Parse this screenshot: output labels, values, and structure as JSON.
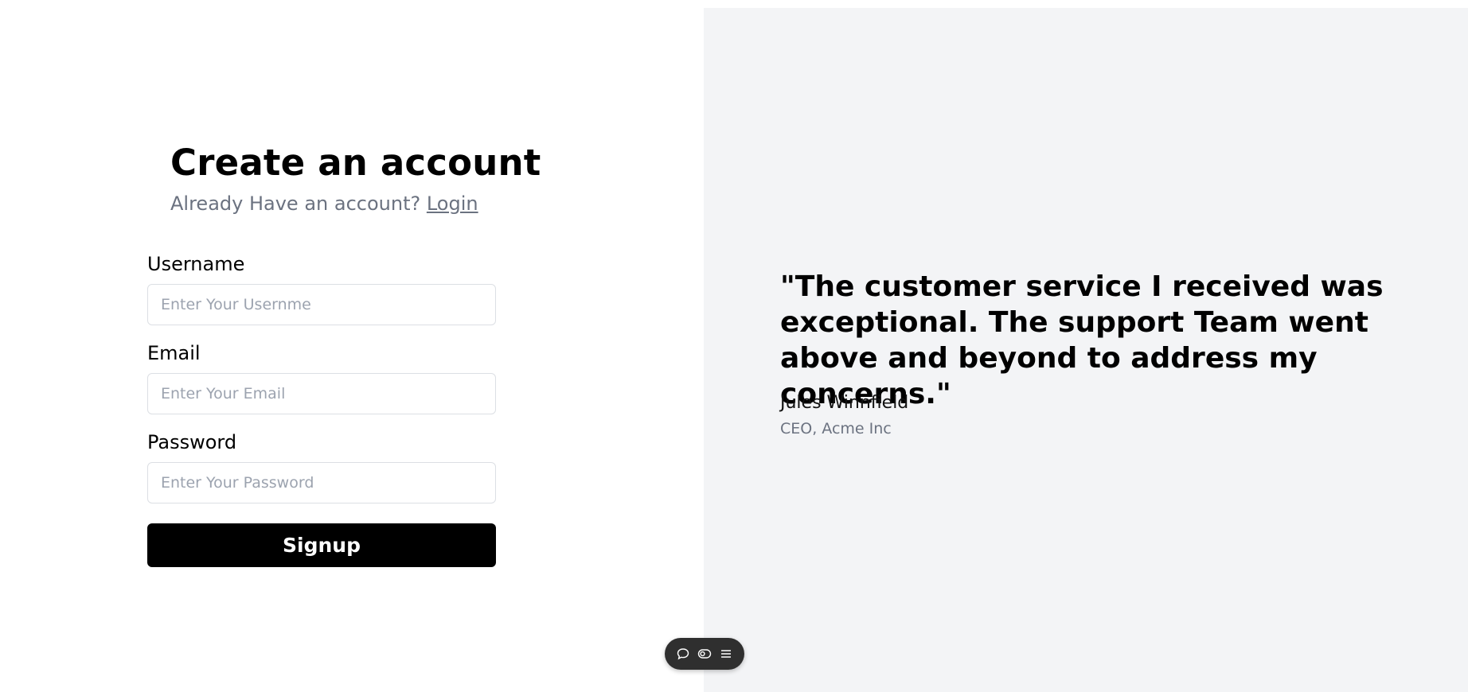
{
  "form": {
    "title": "Create an account",
    "subtitle_prefix": "Already Have an account?",
    "login_link": "Login",
    "username_label": "Username",
    "username_placeholder": "Enter Your Usernme",
    "email_label": "Email",
    "email_placeholder": "Enter Your Email",
    "password_label": "Password",
    "password_placeholder": "Enter Your Password",
    "signup_label": "Signup"
  },
  "testimonial": {
    "quote": "\"The customer service I received was exceptional. The support Team went above and beyond to address my concerns.\"",
    "author_name": "Jules Winnfield",
    "author_title": "CEO, Acme Inc"
  },
  "toolbar": {
    "icons": [
      "comment-icon",
      "toggle-icon",
      "menu-icon"
    ]
  },
  "colors": {
    "panel_background": "#f3f4f6",
    "button_background": "#000000",
    "muted_text": "#6b7280",
    "toolbar_background": "#2f2f2f"
  }
}
